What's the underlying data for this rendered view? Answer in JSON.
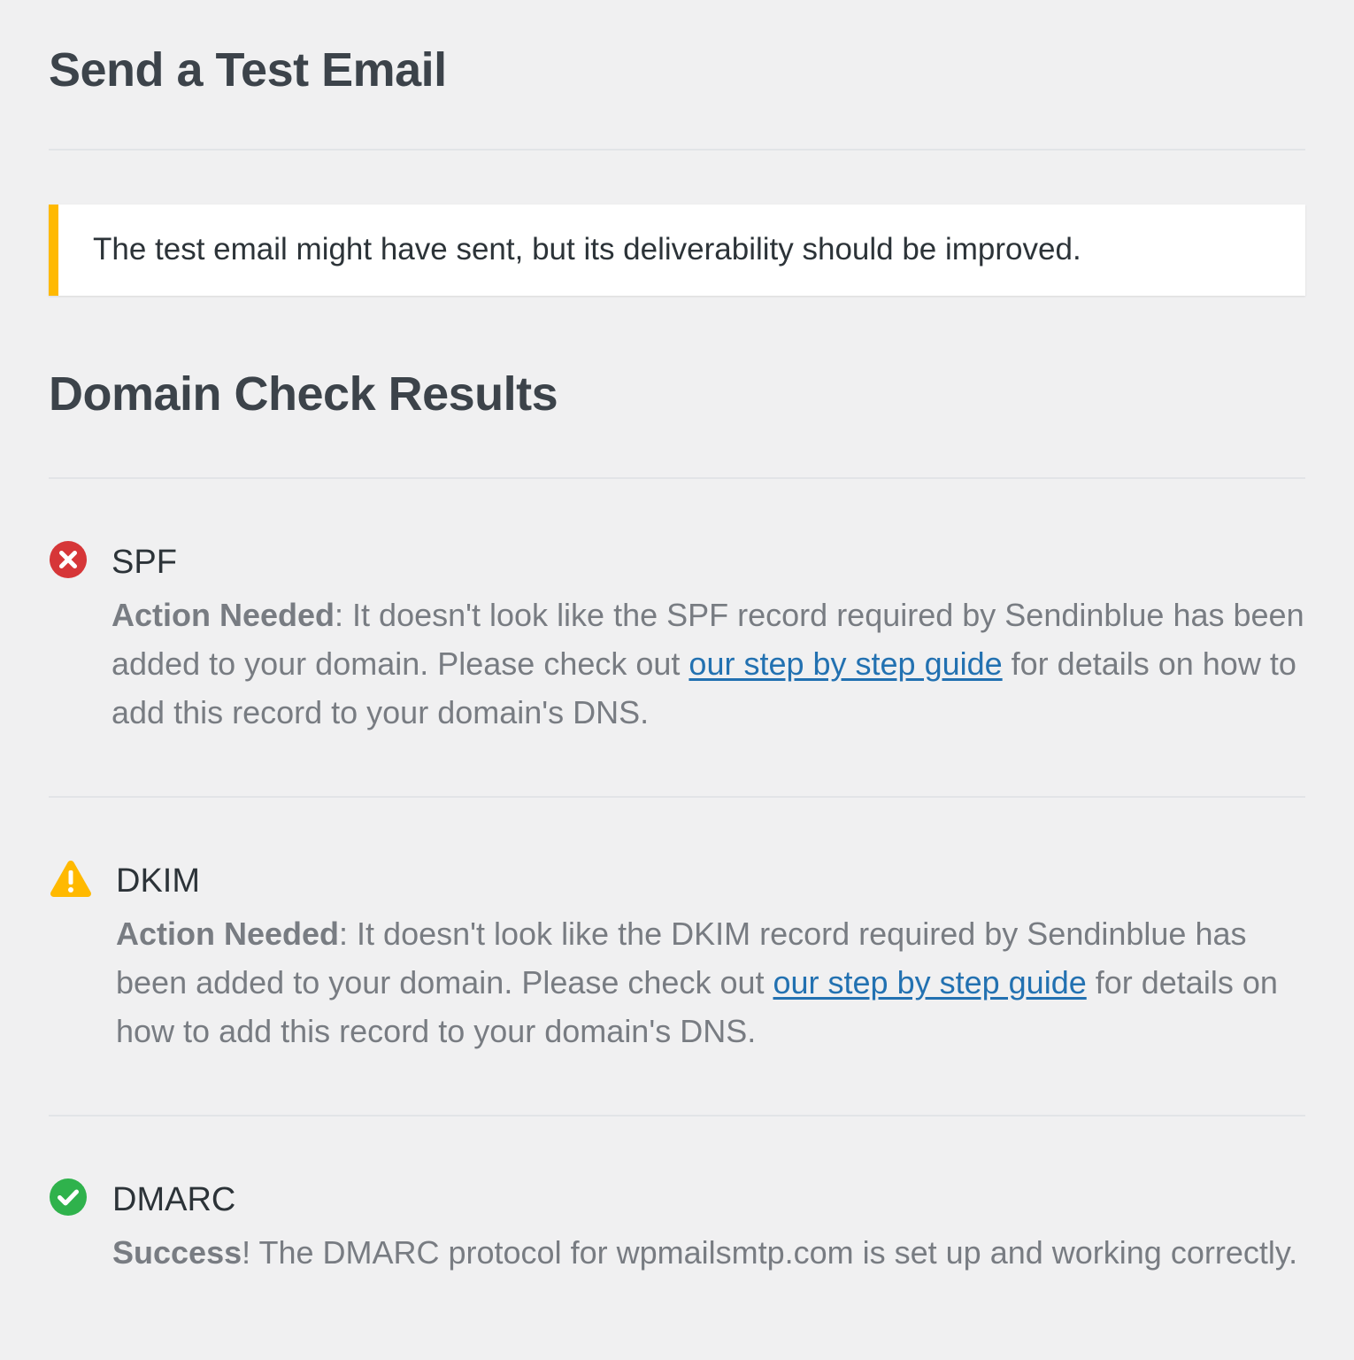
{
  "header": {
    "title": "Send a Test Email"
  },
  "notice": {
    "text": "The test email might have sent, but its deliverability should be improved.",
    "accent_color": "#ffb900"
  },
  "results": {
    "title": "Domain Check Results",
    "checks": [
      {
        "name": "SPF",
        "status": "error",
        "icon": "error-x-icon",
        "status_color": "#d63638",
        "label": "Action Needed",
        "text_before_link": ": It doesn't look like the SPF record required by Sendinblue has been added to your domain. Please check out ",
        "link_text": "our step by step guide",
        "text_after_link": " for details on how to add this record to your domain's DNS."
      },
      {
        "name": "DKIM",
        "status": "warning",
        "icon": "warning-triangle-icon",
        "status_color": "#ffb900",
        "label": "Action Needed",
        "text_before_link": ": It doesn't look like the DKIM record required by Sendinblue has been added to your domain. Please check out ",
        "link_text": "our step by step guide",
        "text_after_link": " for details on how to add this record to your domain's DNS."
      },
      {
        "name": "DMARC",
        "status": "success",
        "icon": "success-check-icon",
        "status_color": "#2fb24c",
        "label": "Success",
        "text_before_link": "! The DMARC protocol for wpmailsmtp.com is set up and working correctly."
      }
    ]
  }
}
